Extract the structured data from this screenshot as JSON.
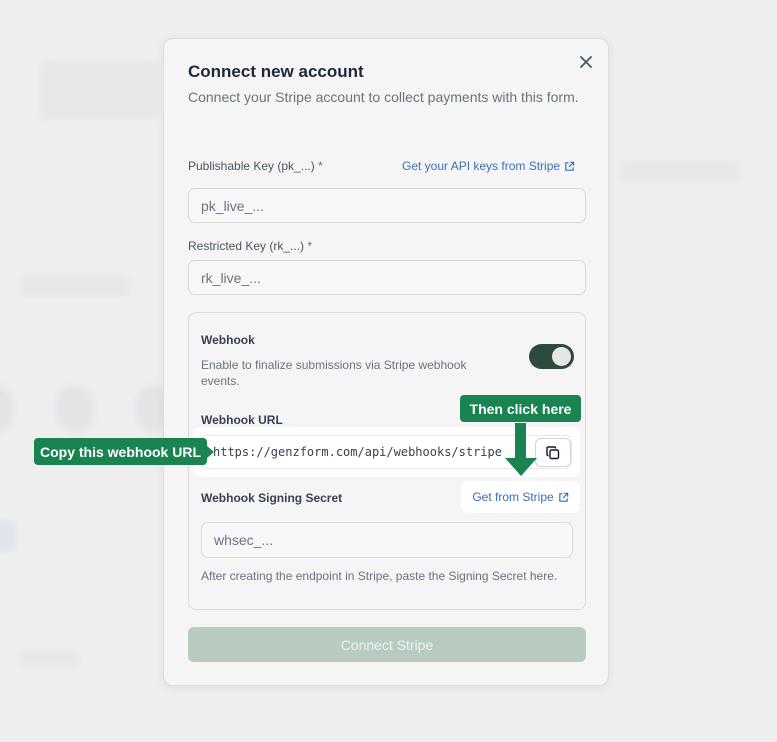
{
  "modal": {
    "title": "Connect new account",
    "description": "Connect your Stripe account to collect payments with this form.",
    "close_icon": "close-icon"
  },
  "publishable_key": {
    "label": "Publishable Key (pk_...)",
    "required_mark": "*",
    "placeholder": "pk_live_...",
    "api_link": "Get your API keys from Stripe",
    "api_link_icon": "external-link-icon"
  },
  "restricted_key": {
    "label": "Restricted Key (rk_...)",
    "required_mark": "*",
    "placeholder": "rk_live_..."
  },
  "webhook": {
    "title": "Webhook",
    "description": "Enable to finalize submissions via Stripe webhook events.",
    "enabled": true,
    "url_label": "Webhook URL",
    "url_value": "https://genzform.com/api/webhooks/stripe",
    "copy_icon": "copy-icon",
    "stripe_link": "Get from Stripe",
    "stripe_link_icon": "external-link-icon",
    "secret_label": "Webhook Signing Secret",
    "secret_placeholder": "whsec_...",
    "secret_help": "After creating the endpoint in Stripe, paste the Signing Secret here."
  },
  "connect_button": "Connect Stripe",
  "callouts": {
    "copy": "Copy this webhook URL",
    "then": "Then click here"
  },
  "colors": {
    "callout_green": "#1a8450",
    "toggle_on": "#2f4a3d",
    "link_blue": "#3b6fb6",
    "button_disabled": "#b7cbc1"
  }
}
